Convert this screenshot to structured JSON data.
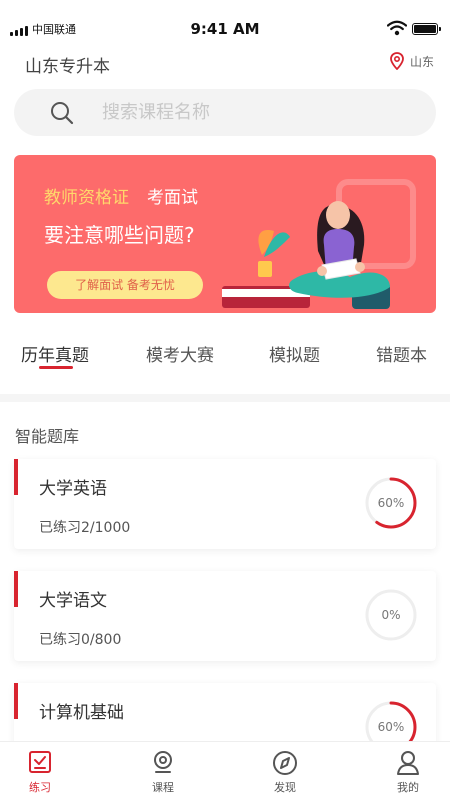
{
  "status_bar": {
    "carrier": "中国联通",
    "time": "9:41 AM"
  },
  "header": {
    "city": "山东专升本",
    "location": "山东"
  },
  "search": {
    "placeholder": "搜索课程名称"
  },
  "banner": {
    "line1_highlight": "教师资格证",
    "line1_rest": "考面试",
    "line2": "要注意哪些问题?",
    "pill": "了解面试 备考无忧"
  },
  "tabs": [
    {
      "label": "历年真题",
      "active": true
    },
    {
      "label": "模考大赛",
      "active": false
    },
    {
      "label": "模拟题",
      "active": false
    },
    {
      "label": "错题本",
      "active": false
    }
  ],
  "section": {
    "title": "智能题库"
  },
  "cards": [
    {
      "title": "大学英语",
      "progress_label": "已练习2/1000",
      "percent_label": "60%",
      "ring_fraction": 0.6
    },
    {
      "title": "大学语文",
      "progress_label": "已练习0/800",
      "percent_label": "0%",
      "ring_fraction": 0
    },
    {
      "title": "计算机基础",
      "progress_label": "",
      "percent_label": "60%",
      "ring_fraction": 0.6
    }
  ],
  "bottom_nav": [
    {
      "label": "练习",
      "icon": "practice-icon",
      "active": true
    },
    {
      "label": "课程",
      "icon": "course-icon",
      "active": false
    },
    {
      "label": "发现",
      "icon": "compass-icon",
      "active": false
    },
    {
      "label": "我的",
      "icon": "profile-icon",
      "active": false
    }
  ],
  "colors": {
    "accent": "#d8242f",
    "banner": "#fd6b6b",
    "highlight": "#ffd86b",
    "pill": "#fde88f"
  }
}
